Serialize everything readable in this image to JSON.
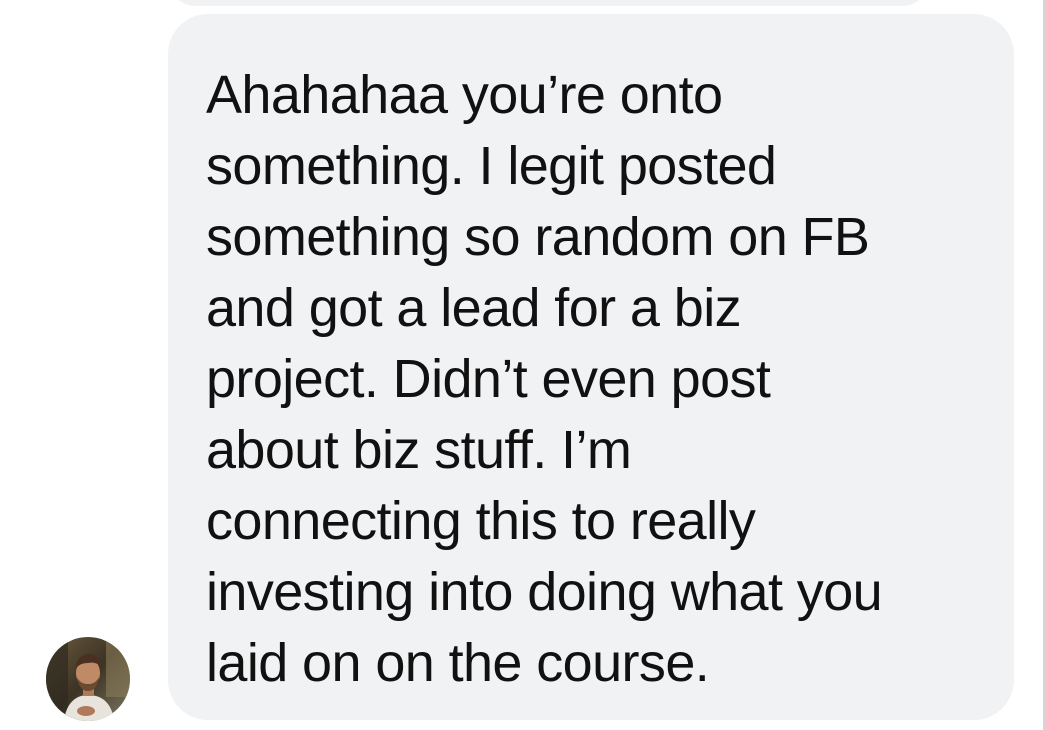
{
  "conversation": {
    "message": {
      "text": "Ahahahaa you’re onto\nsomething. I legit posted\nsomething so random on FB\nand got a lead for a biz\nproject. Didn’t even post\nabout biz stuff. I’m\nconnecting this to really\ninvesting into doing what you\nlaid on on the course."
    },
    "sender_avatar_icon": "user-photo-avatar"
  },
  "colors": {
    "bubble_background": "#f1f2f4",
    "message_text": "#111111",
    "page_background": "#ffffff"
  }
}
